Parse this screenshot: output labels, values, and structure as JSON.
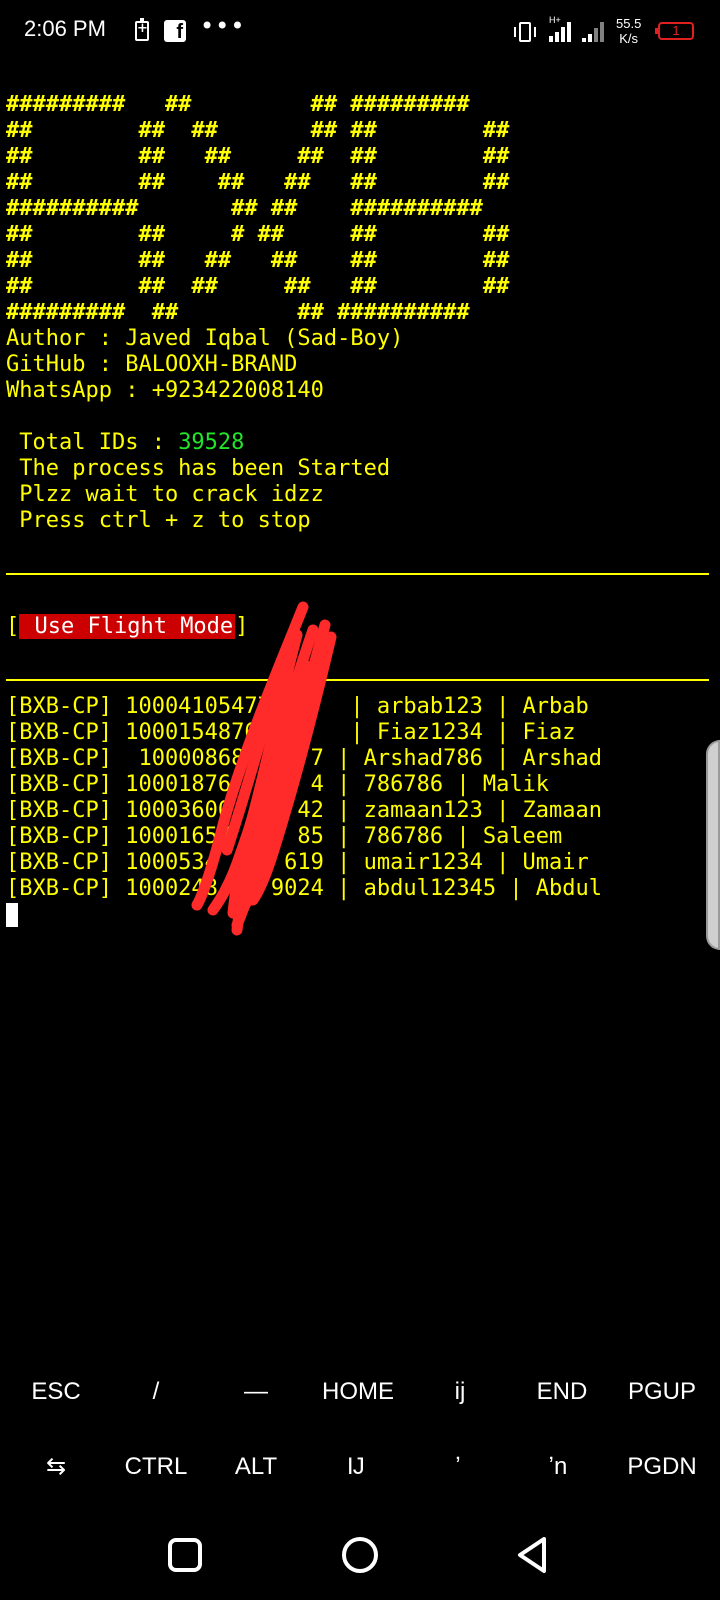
{
  "status_bar": {
    "time": "2:06 PM",
    "battery_saver_symbol": "+",
    "facebook_symbol": "f",
    "more_dots": "•••",
    "network_type": "H+",
    "speed_value": "55.5",
    "speed_unit": "K/s",
    "battery_level": "1"
  },
  "terminal": {
    "banner": [
      "#########   ##         ## #########",
      "##        ##  ##       ## ##        ##",
      "##        ##   ##     ##  ##        ##",
      "##        ##    ##   ##   ##        ##",
      "##########       ## ##    ##########",
      "##        ##     # ##     ##        ##",
      "##        ##   ##   ##    ##        ##",
      "##        ##  ##     ##   ##        ##",
      "#########  ##         ## ##########"
    ],
    "author_line": "Author : Javed Iqbal (Sad-Boy)",
    "github_line": "GitHub : BALOOXH-BRAND",
    "whatsapp_line": "WhatsApp : +923422008140",
    "total_ids_label": " Total IDs : ",
    "total_ids_value": "39528",
    "process_line": " The process has been Started",
    "wait_line": " Plzz wait to crack idzz",
    "stop_line": " Press ctrl + z to stop",
    "flight_prefix": "[",
    "flight_label": " Use Flight Mode",
    "flight_suffix": "]",
    "results": [
      "[BXB-CP] 10004105477      | arbab123 | Arbab",
      "[BXB-CP] 10001548763      | Fiaz1234 | Fiaz",
      "[BXB-CP]  10000868     7 | Arshad786 | Arshad",
      "[BXB-CP] 10001876      4 | 786786 | Malik",
      "[BXB-CP] 10003600     42 | zamaan123 | Zamaan",
      "[BXB-CP] 10001657     85 | 786786 | Saleem",
      "[BXB-CP] 1000534     619 | umair1234 | Umair",
      "[BXB-CP] 1000248    9024 | abdul12345 | Abdul"
    ]
  },
  "extra_keys": {
    "row1": [
      "ESC",
      "/",
      "—",
      "HOME",
      "ij",
      "END",
      "PGUP"
    ],
    "row2": [
      "⇆",
      "CTRL",
      "ALT",
      "Ĳ",
      "ʼ",
      "ʼn",
      "PGDN"
    ]
  },
  "colors": {
    "terminal_text": "#ffff00",
    "total_ids_value": "#22e42a",
    "flight_badge_bg": "#cc0000",
    "scribble": "#ff2a2a"
  },
  "icons": {
    "nav_recents": "square-icon",
    "nav_home": "circle-icon",
    "nav_back": "triangle-back-icon"
  }
}
